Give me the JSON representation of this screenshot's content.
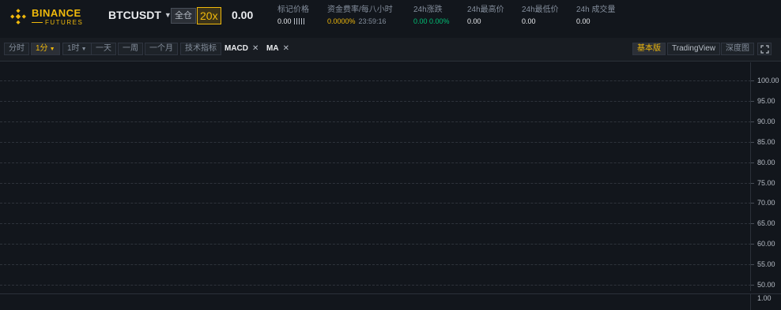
{
  "header": {
    "logo": {
      "brand": "BINANCE",
      "sub": "FUTURES"
    },
    "symbol": "BTCUSDT",
    "margin_mode": "全仓",
    "leverage": "20x",
    "last_price": "0.00",
    "stats": {
      "mark_price": {
        "label": "标记价格",
        "value": "0.00"
      },
      "funding": {
        "label": "资金费率/每八小时",
        "rate": "0.0000%",
        "countdown": "23:59:16"
      },
      "change_24h": {
        "label": "24h涨跌",
        "value": "0.00 0.00%"
      },
      "high_24h": {
        "label": "24h最高价",
        "value": "0.00"
      },
      "low_24h": {
        "label": "24h最低价",
        "value": "0.00"
      },
      "volume_24h": {
        "label": "24h 成交量",
        "value": "0.00"
      }
    }
  },
  "toolbar": {
    "timeframes": [
      {
        "label": "分时"
      },
      {
        "label": "1分",
        "active": true,
        "dropdown": true
      },
      {
        "label": "1时",
        "dropdown": true
      },
      {
        "label": "一天"
      },
      {
        "label": "一周"
      },
      {
        "label": "一个月"
      }
    ],
    "indicators_button": "技术指标",
    "active_indicators": [
      {
        "label": "MACD"
      },
      {
        "label": "MA"
      }
    ],
    "views": {
      "basic": "基本版",
      "tradingview": "TradingView",
      "depth": "深度图"
    }
  },
  "chart": {
    "y_axis_labels": [
      "100.00",
      "95.00",
      "90.00",
      "85.00",
      "80.00",
      "75.00",
      "70.00",
      "65.00",
      "60.00",
      "55.00",
      "50.00"
    ],
    "sub_pane_label": "1.00"
  },
  "colors": {
    "accent": "#f0b90b",
    "up": "#02c076",
    "background": "#12161c"
  }
}
